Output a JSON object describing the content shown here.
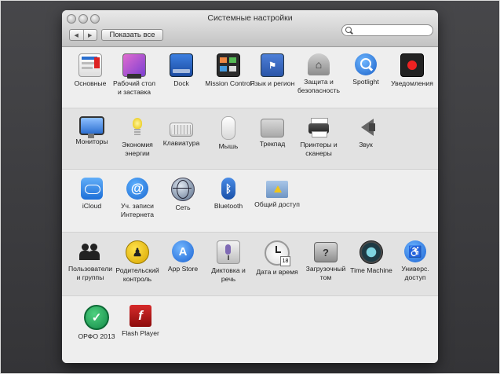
{
  "window": {
    "title": "Системные настройки"
  },
  "toolbar": {
    "back": "◀",
    "forward": "▶",
    "show_all_label": "Показать все",
    "search_placeholder": ""
  },
  "rows": [
    {
      "items": [
        {
          "name": "general",
          "label": "Основные",
          "icon": "general-icon"
        },
        {
          "name": "desktop-screensaver",
          "label": "Рабочий стол и заставка",
          "icon": "desktop-icon"
        },
        {
          "name": "dock",
          "label": "Dock",
          "icon": "dock-icon"
        },
        {
          "name": "mission-control",
          "label": "Mission Control",
          "icon": "mission-control-icon"
        },
        {
          "name": "language-region",
          "label": "Язык и регион",
          "icon": "flag-icon"
        },
        {
          "name": "security",
          "label": "Защита и безопасность",
          "icon": "house-lock-icon"
        },
        {
          "name": "spotlight",
          "label": "Spotlight",
          "icon": "spotlight-icon"
        },
        {
          "name": "notifications",
          "label": "Уведомления",
          "icon": "notifications-icon"
        }
      ]
    },
    {
      "items": [
        {
          "name": "displays",
          "label": "Мониторы",
          "icon": "monitor-icon"
        },
        {
          "name": "energy-saver",
          "label": "Экономия энергии",
          "icon": "bulb-icon"
        },
        {
          "name": "keyboard",
          "label": "Клавиатура",
          "icon": "keyboard-icon"
        },
        {
          "name": "mouse",
          "label": "Мышь",
          "icon": "mouse-icon"
        },
        {
          "name": "trackpad",
          "label": "Трекпад",
          "icon": "trackpad-icon"
        },
        {
          "name": "printers-scanners",
          "label": "Принтеры и сканеры",
          "icon": "printer-icon"
        },
        {
          "name": "sound",
          "label": "Звук",
          "icon": "speaker-icon"
        }
      ]
    },
    {
      "items": [
        {
          "name": "icloud",
          "label": "iCloud",
          "icon": "cloud-icon"
        },
        {
          "name": "internet-accounts",
          "label": "Уч. записи Интернета",
          "icon": "at-icon"
        },
        {
          "name": "network",
          "label": "Сеть",
          "icon": "globe-icon"
        },
        {
          "name": "bluetooth",
          "label": "Bluetooth",
          "icon": "bluetooth-icon"
        },
        {
          "name": "sharing",
          "label": "Общий доступ",
          "icon": "folder-icon"
        }
      ]
    },
    {
      "items": [
        {
          "name": "users-groups",
          "label": "Пользователи и группы",
          "icon": "users-icon"
        },
        {
          "name": "parental-controls",
          "label": "Родительский контроль",
          "icon": "parental-icon"
        },
        {
          "name": "app-store",
          "label": "App Store",
          "icon": "appstore-icon"
        },
        {
          "name": "dictation-speech",
          "label": "Диктовка и речь",
          "icon": "microphone-icon"
        },
        {
          "name": "date-time",
          "label": "Дата и время",
          "icon": "clock-icon"
        },
        {
          "name": "startup-disk",
          "label": "Загрузочный том",
          "icon": "disk-icon"
        },
        {
          "name": "time-machine",
          "label": "Time Machine",
          "icon": "time-machine-icon"
        },
        {
          "name": "accessibility",
          "label": "Универс. доступ",
          "icon": "accessibility-icon"
        }
      ]
    },
    {
      "items": [
        {
          "name": "orfo",
          "label": "ОРФО 2013",
          "icon": "checkmark-icon"
        },
        {
          "name": "flash-player",
          "label": "Flash Player",
          "icon": "flash-icon"
        }
      ]
    }
  ],
  "colors": {
    "window_bg": "#ececec",
    "section_alt": "#e2e2e2",
    "accent_blue": "#2f7fd6"
  }
}
